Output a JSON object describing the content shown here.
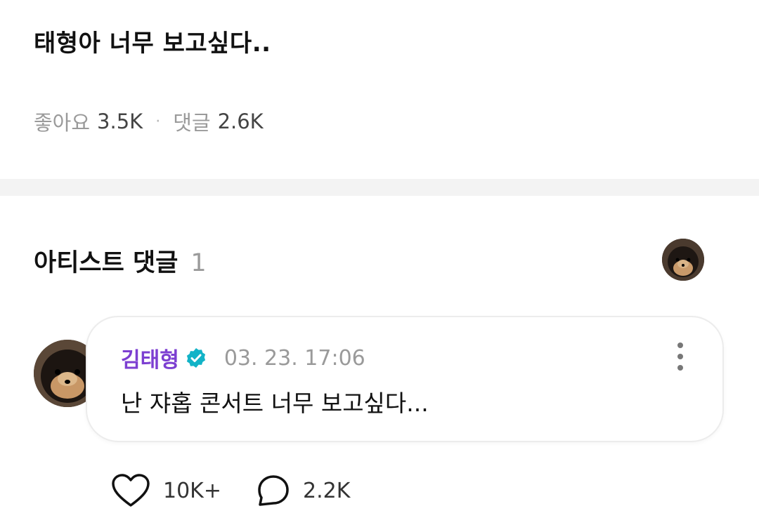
{
  "post": {
    "text": "태형아 너무 보고싶다..",
    "likes_label": "좋아요",
    "likes_count": "3.5K",
    "separator": "·",
    "comments_label": "댓글",
    "comments_count": "2.6K"
  },
  "artist_comments": {
    "title": "아티스트 댓글",
    "count": "1"
  },
  "comment": {
    "author": "김태형",
    "timestamp": "03. 23. 17:06",
    "body": "난 쟈홉 콘서트 너무 보고싶다...",
    "like_count": "10K+",
    "reply_count": "2.2K"
  },
  "colors": {
    "author_purple": "#7c3fd1",
    "verified_teal": "#12b3c7",
    "muted_gray": "#9a9a9a"
  },
  "icons": [
    "verified-badge-icon",
    "more-vertical-icon",
    "heart-icon",
    "comment-bubble-icon"
  ]
}
